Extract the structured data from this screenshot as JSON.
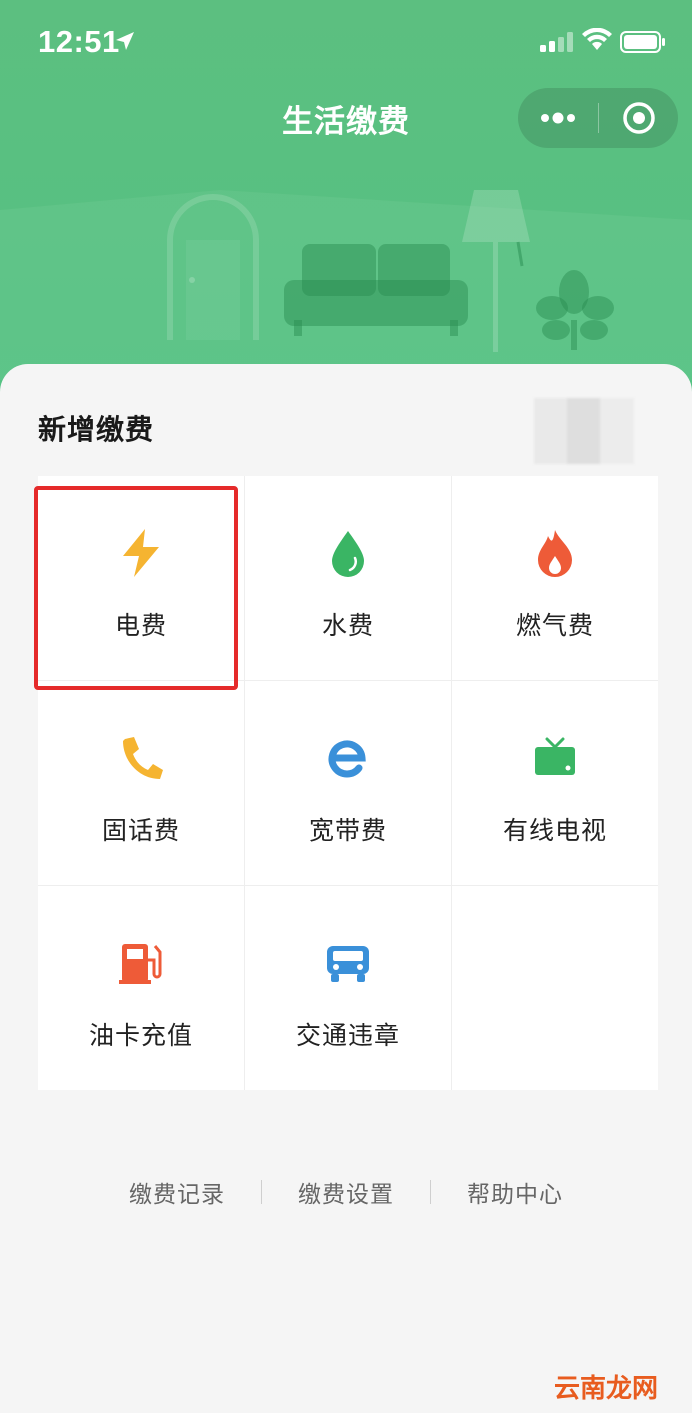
{
  "status_bar": {
    "time": "12:51"
  },
  "nav": {
    "title": "生活缴费"
  },
  "section": {
    "title": "新增缴费"
  },
  "services": [
    {
      "label": "电费",
      "icon": "lightning-icon",
      "color": "#f5b431"
    },
    {
      "label": "水费",
      "icon": "water-drop-icon",
      "color": "#3ab564"
    },
    {
      "label": "燃气费",
      "icon": "flame-icon",
      "color": "#ee5b38"
    },
    {
      "label": "固话费",
      "icon": "phone-icon",
      "color": "#f5b431"
    },
    {
      "label": "宽带费",
      "icon": "broadband-e-icon",
      "color": "#3a90d9"
    },
    {
      "label": "有线电视",
      "icon": "tv-icon",
      "color": "#3ab564"
    },
    {
      "label": "油卡充值",
      "icon": "fuel-pump-icon",
      "color": "#ee5b38"
    },
    {
      "label": "交通违章",
      "icon": "car-icon",
      "color": "#3a90d9"
    }
  ],
  "footer": {
    "records": "缴费记录",
    "settings": "缴费设置",
    "help": "帮助中心"
  },
  "watermark": "云南龙网",
  "colors": {
    "header": "#54c283",
    "highlight": "#e52a2a"
  }
}
